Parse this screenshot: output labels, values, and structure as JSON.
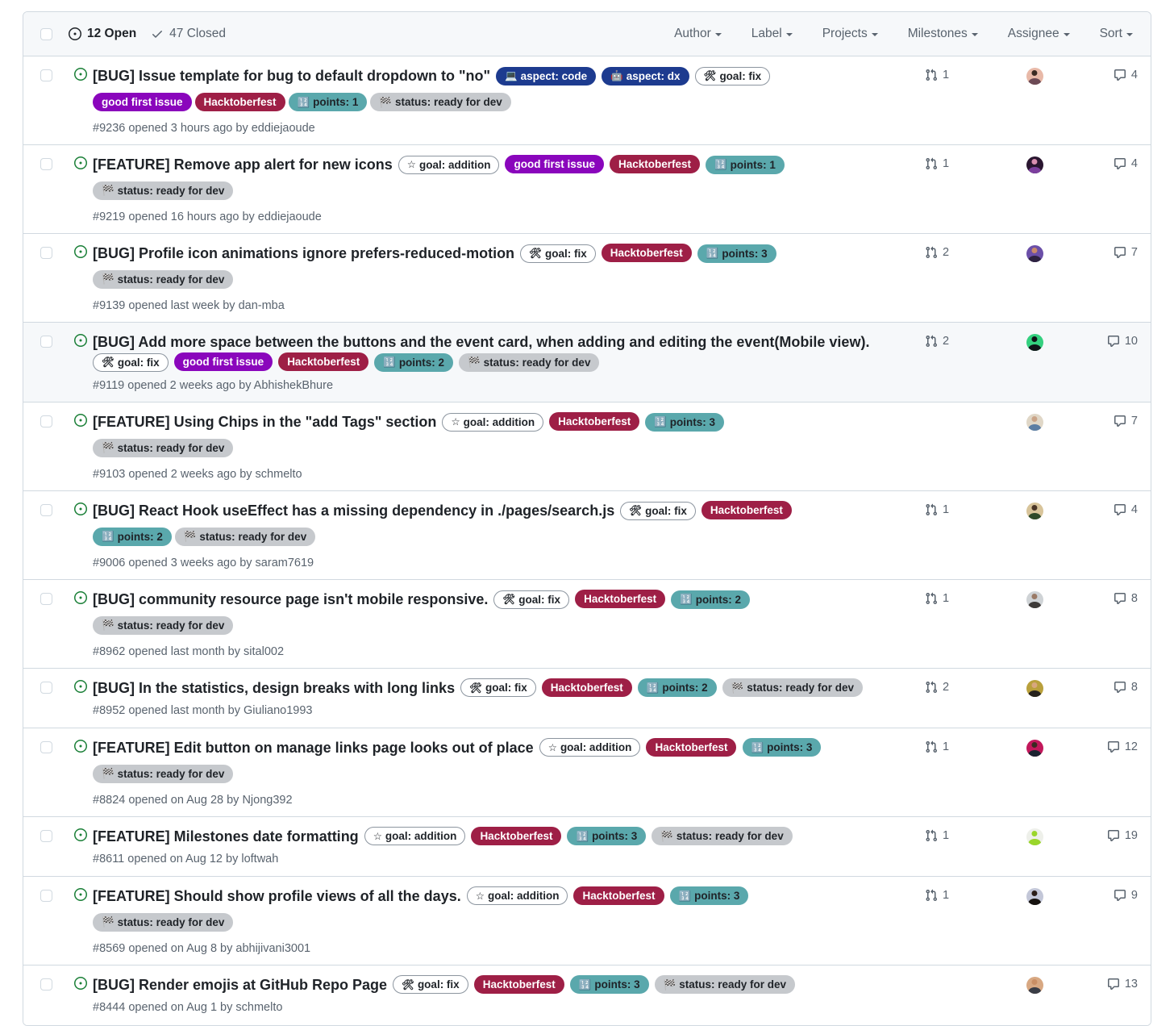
{
  "header": {
    "open_label": "12 Open",
    "closed_label": "47 Closed",
    "open_icon": "issue-opened-icon",
    "closed_icon": "check-icon",
    "dropdowns": [
      {
        "label": "Author"
      },
      {
        "label": "Label"
      },
      {
        "label": "Projects"
      },
      {
        "label": "Milestones"
      },
      {
        "label": "Assignee"
      },
      {
        "label": "Sort"
      }
    ]
  },
  "label_styles": {
    "aspect: code": {
      "bg": "#1d3b8f",
      "fg": "#ffffff",
      "emoji": "💻",
      "border": "transparent"
    },
    "aspect: dx": {
      "bg": "#1d3b8f",
      "fg": "#ffffff",
      "emoji": "🤖",
      "border": "transparent"
    },
    "goal: fix": {
      "bg": "#ffffff",
      "fg": "#1f2328",
      "emoji": "🛠",
      "border": "#8c959f"
    },
    "goal: addition": {
      "bg": "#ffffff",
      "fg": "#1f2328",
      "emoji": "☆",
      "border": "#8c959f"
    },
    "good first issue": {
      "bg": "#8a06bc",
      "fg": "#ffffff",
      "emoji": "",
      "border": "transparent"
    },
    "Hacktoberfest": {
      "bg": "#9e1f46",
      "fg": "#ffffff",
      "emoji": "",
      "border": "transparent"
    },
    "points: 1": {
      "bg": "#5aa8ac",
      "fg": "#1f2328",
      "emoji": "🔢",
      "border": "transparent"
    },
    "points: 2": {
      "bg": "#5aa8ac",
      "fg": "#1f2328",
      "emoji": "🔢",
      "border": "transparent"
    },
    "points: 3": {
      "bg": "#5aa8ac",
      "fg": "#1f2328",
      "emoji": "🔢",
      "border": "transparent"
    },
    "status: ready for dev": {
      "bg": "#c6c9cd",
      "fg": "#1f2328",
      "emoji": "🏁",
      "border": "transparent"
    }
  },
  "issues": [
    {
      "state": "open",
      "title": "[BUG] Issue template for bug to default dropdown to \"no\"",
      "inline_labels": [
        "aspect: code",
        "aspect: dx",
        "goal: fix"
      ],
      "wrapped_labels": [
        "good first issue",
        "Hacktoberfest",
        "points: 1",
        "status: ready for dev"
      ],
      "meta": "#9236 opened 3 hours ago by eddiejaoude",
      "pr_count": "1",
      "comments": "4",
      "avatar": {
        "bg": "#e8b9a8",
        "head": "#3a2a22",
        "body": "#6c4a55"
      },
      "highlight": false
    },
    {
      "state": "open",
      "title": "[FEATURE] Remove app alert for new icons",
      "inline_labels": [
        "goal: addition",
        "good first issue",
        "Hacktoberfest",
        "points: 1"
      ],
      "wrapped_labels": [
        "status: ready for dev"
      ],
      "meta": "#9219 opened 16 hours ago by eddiejaoude",
      "pr_count": "1",
      "comments": "4",
      "avatar": {
        "bg": "#2a1630",
        "head": "#d98fb0",
        "body": "#7c3f9e"
      },
      "highlight": false
    },
    {
      "state": "open",
      "title": "[BUG] Profile icon animations ignore prefers-reduced-motion",
      "inline_labels": [
        "goal: fix",
        "Hacktoberfest",
        "points: 3"
      ],
      "wrapped_labels": [
        "status: ready for dev"
      ],
      "meta": "#9139 opened last week by dan-mba",
      "pr_count": "2",
      "comments": "7",
      "avatar": {
        "bg": "#6b4fa8",
        "head": "#c98a6a",
        "body": "#2d2240"
      },
      "highlight": false
    },
    {
      "state": "open",
      "title": "[BUG] Add more space between the buttons and the event card, when adding and editing the event(Mobile view).",
      "inline_labels": [
        "goal: fix",
        "good first issue",
        "Hacktoberfest",
        "points: 2",
        "status: ready for dev"
      ],
      "wrapped_labels": [],
      "meta": "#9119 opened 2 weeks ago by AbhishekBhure",
      "pr_count": "2",
      "comments": "10",
      "avatar": {
        "bg": "#34d07f",
        "head": "#101418",
        "body": "#101418"
      },
      "highlight": true
    },
    {
      "state": "open",
      "title": "[FEATURE] Using Chips in the \"add Tags\" section",
      "inline_labels": [
        "goal: addition",
        "Hacktoberfest",
        "points: 3"
      ],
      "wrapped_labels": [
        "status: ready for dev"
      ],
      "meta": "#9103 opened 2 weeks ago by schmelto",
      "pr_count": "",
      "comments": "7",
      "avatar": {
        "bg": "#e0d7c7",
        "head": "#caa488",
        "body": "#5c7ea3"
      },
      "highlight": false
    },
    {
      "state": "open",
      "title": "[BUG] React Hook useEffect has a missing dependency in ./pages/search.js",
      "inline_labels": [
        "goal: fix",
        "Hacktoberfest"
      ],
      "wrapped_labels": [
        "points: 2",
        "status: ready for dev"
      ],
      "meta": "#9006 opened 3 weeks ago by saram7619",
      "pr_count": "1",
      "comments": "4",
      "avatar": {
        "bg": "#d8c49a",
        "head": "#4a3526",
        "body": "#2f4a2a"
      },
      "highlight": false
    },
    {
      "state": "open",
      "title": "[BUG] community resource page isn't mobile responsive.",
      "inline_labels": [
        "goal: fix",
        "Hacktoberfest",
        "points: 2"
      ],
      "wrapped_labels": [
        "status: ready for dev"
      ],
      "meta": "#8962 opened last month by sital002",
      "pr_count": "1",
      "comments": "8",
      "avatar": {
        "bg": "#cfd3d6",
        "head": "#9a7a66",
        "body": "#3d3a38"
      },
      "highlight": false
    },
    {
      "state": "open",
      "title": "[BUG] In the statistics, design breaks with long links",
      "inline_labels": [
        "goal: fix",
        "Hacktoberfest",
        "points: 2",
        "status: ready for dev"
      ],
      "wrapped_labels": [],
      "meta": "#8952 opened last month by Giuliano1993",
      "pr_count": "2",
      "comments": "8",
      "avatar": {
        "bg": "#b9a03c",
        "head": "#d8a77e",
        "body": "#26221c"
      },
      "highlight": false
    },
    {
      "state": "open",
      "title": "[FEATURE] Edit button on manage links page looks out of place",
      "inline_labels": [
        "goal: addition",
        "Hacktoberfest",
        "points: 3"
      ],
      "wrapped_labels": [
        "status: ready for dev"
      ],
      "meta": "#8824 opened on Aug 28 by Njong392",
      "pr_count": "1",
      "comments": "12",
      "avatar": {
        "bg": "#c2185b",
        "head": "#3b2a22",
        "body": "#1b2230"
      },
      "highlight": false
    },
    {
      "state": "open",
      "title": "[FEATURE] Milestones date formatting",
      "inline_labels": [
        "goal: addition",
        "Hacktoberfest",
        "points: 3",
        "status: ready for dev"
      ],
      "wrapped_labels": [],
      "meta": "#8611 opened on Aug 12 by loftwah",
      "pr_count": "1",
      "comments": "19",
      "avatar": {
        "bg": "#eef0ea",
        "head": "#9ad62b",
        "body": "#9ad62b"
      },
      "highlight": false
    },
    {
      "state": "open",
      "title": "[FEATURE] Should show profile views of all the days.",
      "inline_labels": [
        "goal: addition",
        "Hacktoberfest",
        "points: 3"
      ],
      "wrapped_labels": [
        "status: ready for dev"
      ],
      "meta": "#8569 opened on Aug 8 by abhijivani3001",
      "pr_count": "1",
      "comments": "9",
      "avatar": {
        "bg": "#c3c7d8",
        "head": "#2a1d18",
        "body": "#171310"
      },
      "highlight": false
    },
    {
      "state": "open",
      "title": "[BUG] Render emojis at GitHub Repo Page",
      "inline_labels": [
        "goal: fix",
        "Hacktoberfest",
        "points: 3",
        "status: ready for dev"
      ],
      "wrapped_labels": [],
      "meta": "#8444 opened on Aug 1 by schmelto",
      "pr_count": "",
      "comments": "13",
      "avatar": {
        "bg": "#d8a882",
        "head": "#c98e64",
        "body": "#3a3d46"
      },
      "highlight": false
    }
  ]
}
